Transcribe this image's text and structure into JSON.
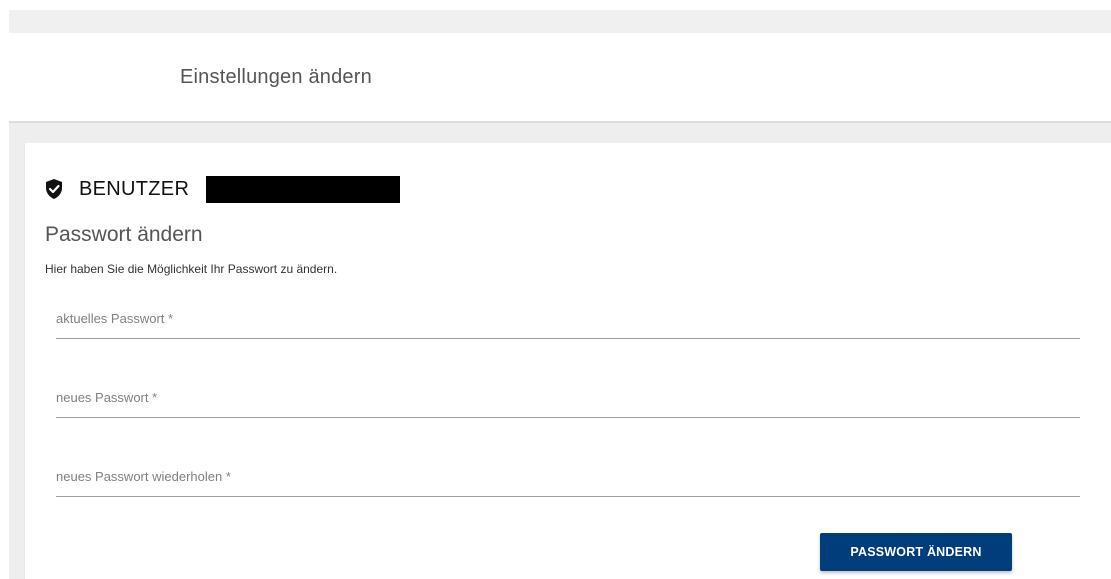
{
  "header": {
    "title": "Einstellungen ändern"
  },
  "card": {
    "user_label": "BENUTZER",
    "user_icon": "shield-check-icon",
    "section_title": "Passwort ändern",
    "section_description": "Hier haben Sie die Möglichkeit Ihr Passwort zu ändern.",
    "fields": {
      "current_password": {
        "placeholder": "aktuelles Passwort *",
        "value": ""
      },
      "new_password": {
        "placeholder": "neues Passwort *",
        "value": ""
      },
      "repeat_password": {
        "placeholder": "neues Passwort wiederholen *",
        "value": ""
      }
    },
    "submit_label": "PASSWORT ÄNDERN"
  },
  "colors": {
    "primary_button": "#003d7a",
    "page_background": "#eeeeee"
  }
}
